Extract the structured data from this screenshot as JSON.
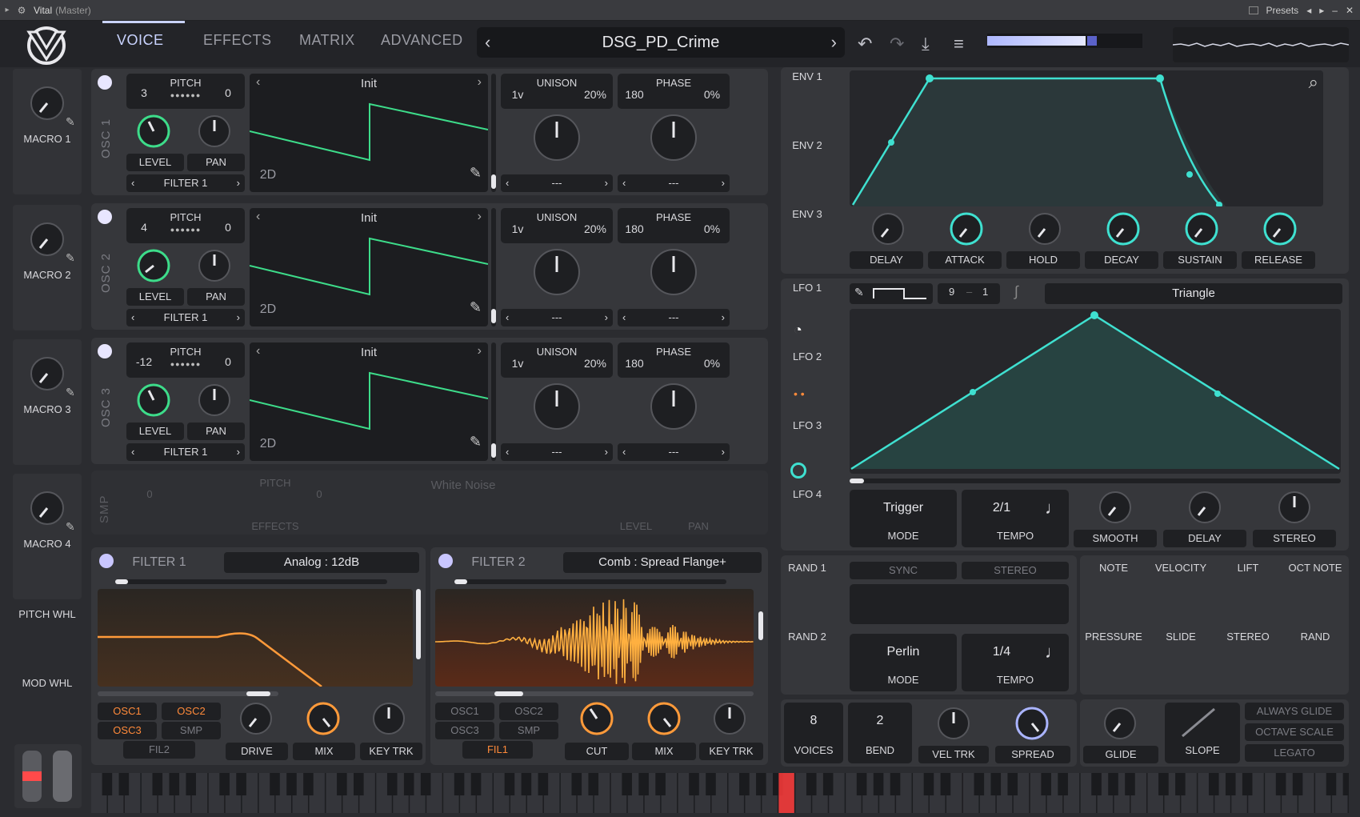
{
  "titlebar": {
    "title": "Vital",
    "subtitle": "(Master)",
    "presets": "Presets"
  },
  "header": {
    "tabs": [
      "VOICE",
      "EFFECTS",
      "MATRIX",
      "ADVANCED"
    ],
    "preset_name": "DSG_PD_Crime"
  },
  "macros": [
    "MACRO 1",
    "MACRO 2",
    "MACRO 3",
    "MACRO 4"
  ],
  "side_labels": {
    "pitch_wheel": "PITCH WHL",
    "mod_wheel": "MOD WHL"
  },
  "oscillators": [
    {
      "label": "OSC 1",
      "transpose": "3",
      "tune": "0",
      "pitch_label": "PITCH",
      "wavetable": "Init",
      "mode": "2D",
      "level_label": "LEVEL",
      "pan_label": "PAN",
      "dest": "FILTER 1",
      "unison_label": "UNISON",
      "voices": "1v",
      "detune": "20%",
      "phase_label": "PHASE",
      "phase": "180",
      "phase_rand": "0%",
      "spectral": "---",
      "distortion": "---"
    },
    {
      "label": "OSC 2",
      "transpose": "4",
      "tune": "0",
      "pitch_label": "PITCH",
      "wavetable": "Init",
      "mode": "2D",
      "level_label": "LEVEL",
      "pan_label": "PAN",
      "dest": "FILTER 1",
      "unison_label": "UNISON",
      "voices": "1v",
      "detune": "20%",
      "phase_label": "PHASE",
      "phase": "180",
      "phase_rand": "0%",
      "spectral": "---",
      "distortion": "---"
    },
    {
      "label": "OSC 3",
      "transpose": "-12",
      "tune": "0",
      "pitch_label": "PITCH",
      "wavetable": "Init",
      "mode": "2D",
      "level_label": "LEVEL",
      "pan_label": "PAN",
      "dest": "FILTER 1",
      "unison_label": "UNISON",
      "voices": "1v",
      "detune": "20%",
      "phase_label": "PHASE",
      "phase": "180",
      "phase_rand": "0%",
      "spectral": "---",
      "distortion": "---"
    }
  ],
  "sampler": {
    "label": "SMP",
    "transpose": "0",
    "tune": "0",
    "pitch_label": "PITCH",
    "sample": "White Noise",
    "dest": "EFFECTS",
    "level_label": "LEVEL",
    "pan_label": "PAN"
  },
  "filter1": {
    "title": "FILTER 1",
    "model": "Analog : 12dB",
    "sources": [
      "OSC1",
      "OSC2",
      "OSC3",
      "SMP",
      "FIL2"
    ],
    "knobs": [
      "DRIVE",
      "MIX",
      "KEY TRK"
    ]
  },
  "filter2": {
    "title": "FILTER 2",
    "model": "Comb : Spread Flange+",
    "sources": [
      "OSC1",
      "OSC2",
      "OSC3",
      "SMP",
      "FIL1"
    ],
    "knobs": [
      "CUT",
      "MIX",
      "KEY TRK"
    ]
  },
  "envelopes": {
    "tabs": [
      "ENV 1",
      "ENV 2",
      "ENV 3"
    ],
    "knobs": [
      "DELAY",
      "ATTACK",
      "HOLD",
      "DECAY",
      "SUSTAIN",
      "RELEASE"
    ]
  },
  "lfos": {
    "tabs": [
      "LFO 1",
      "LFO 2",
      "LFO 3",
      "LFO 4"
    ],
    "grid_x": "9",
    "grid_y": "1",
    "shape": "Triangle",
    "mode_value": "Trigger",
    "mode_label": "MODE",
    "tempo_value": "2/1",
    "tempo_label": "TEMPO",
    "knobs": [
      "SMOOTH",
      "DELAY",
      "STEREO"
    ]
  },
  "random": {
    "tabs": [
      "RAND 1",
      "RAND 2"
    ],
    "sync": "SYNC",
    "stereo": "STEREO",
    "mode_value": "Perlin",
    "mode_label": "MODE",
    "tempo_value": "1/4",
    "tempo_label": "TEMPO"
  },
  "mod_sources": [
    "NOTE",
    "VELOCITY",
    "LIFT",
    "OCT NOTE",
    "PRESSURE",
    "SLIDE",
    "STEREO",
    "RAND"
  ],
  "voice": {
    "voices": "8",
    "voices_label": "VOICES",
    "bend": "2",
    "bend_label": "BEND",
    "vel_trk": "VEL TRK",
    "spread": "SPREAD"
  },
  "glide": {
    "glide": "GLIDE",
    "slope": "SLOPE",
    "options": [
      "ALWAYS GLIDE",
      "OCTAVE SCALE",
      "LEGATO"
    ]
  },
  "colors": {
    "accent": "#aab4ff",
    "osc_green": "#3ddc8a",
    "env_cyan": "#3fe0d0",
    "filter_orange": "#ff8a3a"
  }
}
